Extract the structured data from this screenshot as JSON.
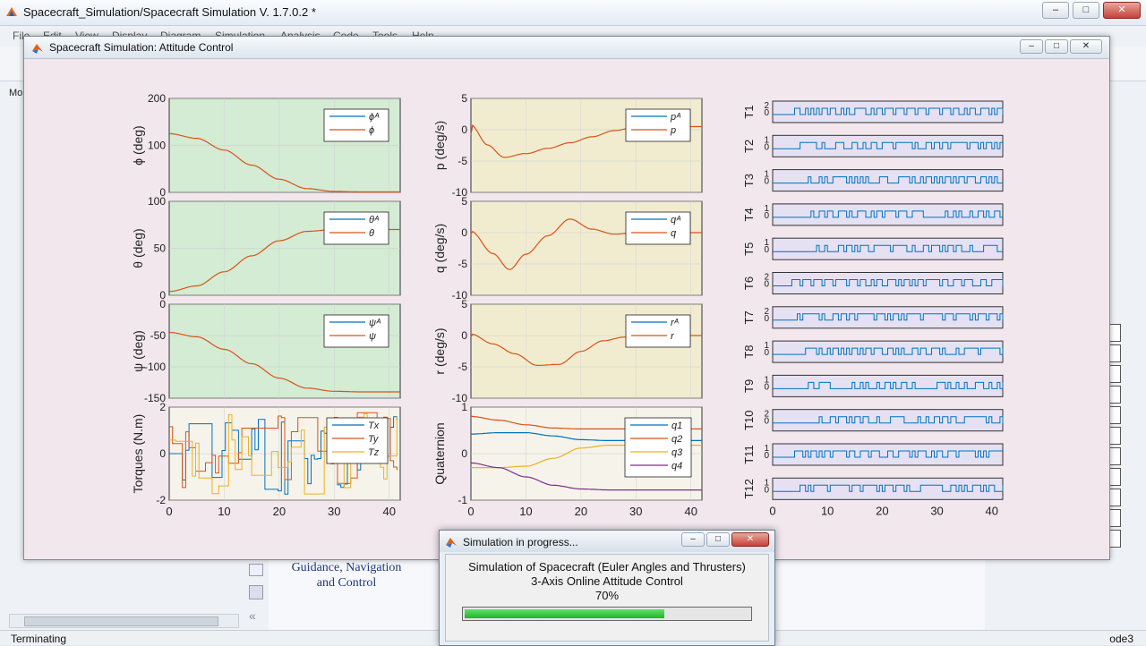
{
  "background_window": {
    "title": "Spacecraft_Simulation/Spacecraft Simulation V. 1.7.0.2 *",
    "menu": [
      "File",
      "Edit",
      "View",
      "Display",
      "Diagram",
      "Simulation",
      "Analysis",
      "Code",
      "Tools",
      "Help"
    ],
    "tab_label": "Mo",
    "canvas_block_text": "Guidance, Navigation and Control",
    "status_left": "Terminating",
    "status_right": "ode3"
  },
  "figure_window": {
    "title": "Spacecraft Simulation: Attitude Control"
  },
  "progress_dialog": {
    "title": "Simulation in progress...",
    "line1": "Simulation of Spacecraft (Euler Angles and Thrusters)",
    "line2": "3-Axis Online Attitude Control",
    "percent_label": "70%",
    "progress": 0.7
  },
  "colors": {
    "blue": "#0072BD",
    "orange": "#D95319",
    "yellow": "#EDB120",
    "purple": "#7E2F8E",
    "green_panel": "#d4ebd4",
    "tan_panel": "#f1ecd0",
    "lilac_panel": "#e5e1f3"
  },
  "chart_data": [
    {
      "type": "line",
      "ylabel": "ϕ (deg)",
      "ylim": [
        0,
        200
      ],
      "yticks": [
        "200",
        "100",
        "0"
      ],
      "legend": [
        "ϕ^Λ",
        "ϕ"
      ],
      "x": [
        0,
        5,
        10,
        15,
        20,
        25,
        30,
        35,
        42
      ],
      "series": [
        {
          "name": "ϕ",
          "values": [
            125,
            115,
            90,
            58,
            28,
            8,
            2,
            1,
            1
          ]
        }
      ]
    },
    {
      "type": "line",
      "ylabel": "θ (deg)",
      "ylim": [
        0,
        100
      ],
      "yticks": [
        "100",
        "50",
        "0"
      ],
      "legend": [
        "θ^Λ",
        "θ"
      ],
      "x": [
        0,
        5,
        10,
        15,
        20,
        25,
        30,
        35,
        42
      ],
      "series": [
        {
          "name": "θ",
          "values": [
            4,
            10,
            25,
            42,
            58,
            68,
            70,
            70,
            70
          ]
        }
      ]
    },
    {
      "type": "line",
      "ylabel": "ψ (deg)",
      "ylim": [
        -150,
        0
      ],
      "yticks": [
        "0",
        "-50",
        "-100",
        "-150"
      ],
      "legend": [
        "ψ^Λ",
        "ψ"
      ],
      "x": [
        0,
        5,
        10,
        15,
        20,
        25,
        30,
        35,
        42
      ],
      "series": [
        {
          "name": "ψ",
          "values": [
            -45,
            -52,
            -72,
            -95,
            -118,
            -134,
            -139,
            -140,
            -140
          ]
        }
      ]
    },
    {
      "type": "line",
      "ylabel": "Torques (N.m)",
      "ylim": [
        -2,
        2
      ],
      "yticks": [
        "2",
        "0",
        "-2"
      ],
      "xticks": [
        "0",
        "10",
        "20",
        "30",
        "40"
      ],
      "legend": [
        "Tx",
        "Ty",
        "Tz"
      ]
    },
    {
      "type": "line",
      "ylabel": "p (deg/s)",
      "ylim": [
        -10,
        5
      ],
      "yticks": [
        "5",
        "0",
        "-5",
        "-10"
      ],
      "legend": [
        "p^Λ",
        "p"
      ],
      "x": [
        0,
        3,
        6,
        10,
        14,
        18,
        22,
        26,
        30,
        36,
        42
      ],
      "series": [
        {
          "name": "p",
          "values": [
            0,
            -3,
            -4.8,
            -4,
            -3,
            -2,
            -1,
            0,
            0.5,
            0.5,
            0.5
          ]
        }
      ]
    },
    {
      "type": "line",
      "ylabel": "q (deg/s)",
      "ylim": [
        -10,
        5
      ],
      "yticks": [
        "5",
        "0",
        "-5",
        "-10"
      ],
      "legend": [
        "q^Λ",
        "q"
      ],
      "x": [
        0,
        4,
        7,
        10,
        14,
        18,
        22,
        26,
        30,
        36,
        42
      ],
      "series": [
        {
          "name": "q",
          "values": [
            0,
            -3.5,
            -6,
            -3.5,
            -0.5,
            2.2,
            0.6,
            -0.2,
            0,
            0,
            0
          ]
        }
      ]
    },
    {
      "type": "line",
      "ylabel": "r (deg/s)",
      "ylim": [
        -10,
        5
      ],
      "yticks": [
        "5",
        "0",
        "-5",
        "-10"
      ],
      "legend": [
        "r^Λ",
        "r"
      ],
      "x": [
        0,
        4,
        8,
        12,
        16,
        20,
        24,
        28,
        32,
        36,
        42
      ],
      "series": [
        {
          "name": "r",
          "values": [
            0,
            -1.5,
            -3,
            -4.8,
            -4.6,
            -2.5,
            -0.8,
            -0.2,
            0,
            0,
            0
          ]
        }
      ]
    },
    {
      "type": "line",
      "ylabel": "Quaternion",
      "ylim": [
        -1,
        1
      ],
      "yticks": [
        "1",
        "0",
        "-1"
      ],
      "xticks": [
        "0",
        "10",
        "20",
        "30",
        "40"
      ],
      "legend": [
        "q1",
        "q2",
        "q3",
        "q4"
      ],
      "x": [
        0,
        5,
        10,
        15,
        20,
        25,
        30,
        35,
        42
      ],
      "series": [
        {
          "name": "q1",
          "values": [
            0.42,
            0.45,
            0.45,
            0.38,
            0.3,
            0.28,
            0.28,
            0.28,
            0.28
          ]
        },
        {
          "name": "q2",
          "values": [
            0.8,
            0.72,
            0.62,
            0.55,
            0.53,
            0.53,
            0.53,
            0.53,
            0.53
          ]
        },
        {
          "name": "q3",
          "values": [
            -0.3,
            -0.3,
            -0.27,
            -0.1,
            0.12,
            0.18,
            0.18,
            0.18,
            0.18
          ]
        },
        {
          "name": "q4",
          "values": [
            -0.2,
            -0.3,
            -0.5,
            -0.68,
            -0.76,
            -0.78,
            -0.78,
            -0.78,
            -0.78
          ]
        }
      ]
    }
  ],
  "thrusters": {
    "labels": [
      "T1",
      "T2",
      "T3",
      "T4",
      "T5",
      "T6",
      "T7",
      "T8",
      "T9",
      "T10",
      "T11",
      "T12"
    ],
    "top_ticks": [
      "2",
      "1",
      "1",
      "1",
      "1",
      "2",
      "2",
      "1",
      "1",
      "2",
      "1",
      "1"
    ],
    "xticks": [
      "0",
      "10",
      "20",
      "30",
      "40"
    ]
  }
}
